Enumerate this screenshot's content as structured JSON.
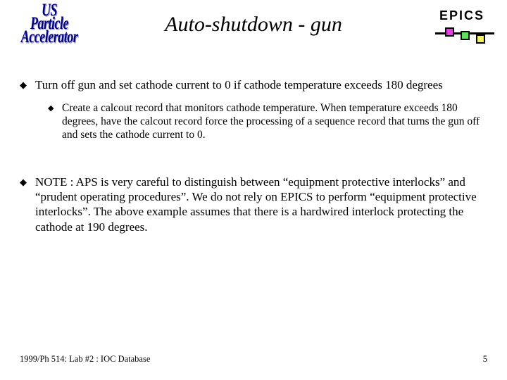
{
  "logo": {
    "line1": "US",
    "line2": "Particle",
    "line3": "Accelerator"
  },
  "title": "Auto-shutdown - gun",
  "epics_label": "EPICS",
  "bullets": {
    "b1": "Turn off gun and set cathode current to 0 if cathode temperature exceeds 180 degrees",
    "b1_sub1": "Create a calcout record that monitors cathode temperature. When temperature exceeds 180 degrees, have the calcout record force the processing of a sequence record that turns the gun off and sets the cathode current to 0.",
    "b2": "NOTE : APS is very careful to distinguish between “equipment protective interlocks” and “prudent operating procedures”. We do not rely on EPICS to perform “equipment protective interlocks”. The above example assumes that there is a hardwired interlock protecting the cathode at 190 degrees."
  },
  "footer": {
    "left": "1999/Ph 514: Lab #2 : IOC Database",
    "right": "5"
  }
}
